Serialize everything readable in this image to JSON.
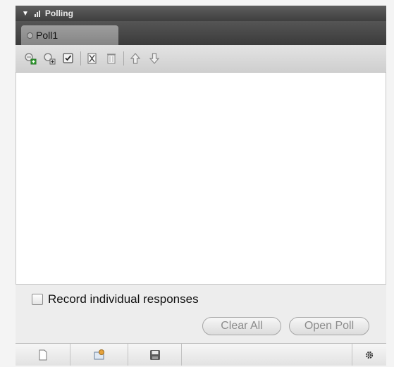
{
  "panel": {
    "title": "Polling",
    "collapse_icon": "triangle-down-icon",
    "panel_icon": "bar-graph-icon"
  },
  "tabs": [
    {
      "label": "Poll1",
      "icon": "status-dot-icon"
    }
  ],
  "toolbar": {
    "buttons": [
      {
        "name": "add-poll-button",
        "icon": "add-poll-icon"
      },
      {
        "name": "add-question-button",
        "icon": "add-question-icon"
      },
      {
        "name": "add-answer-button",
        "icon": "checkbox-answer-icon"
      },
      {
        "name": "cut-button",
        "icon": "cut-icon"
      },
      {
        "name": "delete-button",
        "icon": "trash-icon"
      },
      {
        "name": "move-up-button",
        "icon": "arrow-up-icon"
      },
      {
        "name": "move-down-button",
        "icon": "arrow-down-icon"
      }
    ]
  },
  "options": {
    "record_label": "Record individual responses",
    "record_checked": false
  },
  "actions": {
    "clear_all": "Clear All",
    "open_poll": "Open Poll"
  },
  "bottom_bar": {
    "icons": [
      "new-document-icon",
      "share-icon",
      "save-icon",
      "gear-icon"
    ]
  },
  "colors": {
    "header_dark": "#4a4a4a",
    "tab_gray": "#929292",
    "disabled_text": "#8c8c8c"
  }
}
